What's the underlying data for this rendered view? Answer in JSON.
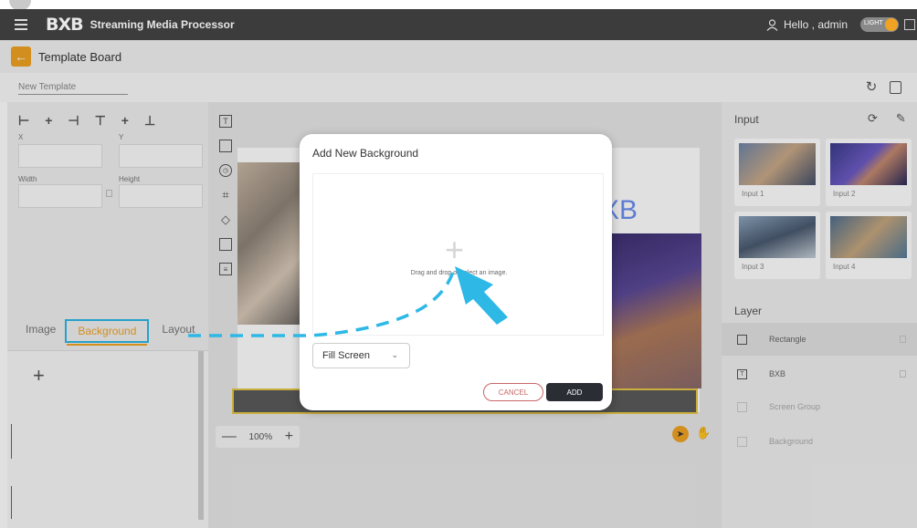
{
  "header": {
    "logo_text": "BXB",
    "app_title": "Streaming Media Processor",
    "greeting": "Hello , admin",
    "toggle_label": "LIGHT",
    "accent": "#f0a323"
  },
  "subheader": {
    "back_icon": "arrow-left-icon",
    "title": "Template Board"
  },
  "template": {
    "name_placeholder": "New Template"
  },
  "properties": {
    "x_label": "X",
    "y_label": "Y",
    "width_label": "Width",
    "height_label": "Height"
  },
  "tabs": {
    "image": "Image",
    "background": "Background",
    "layout": "Layout"
  },
  "canvas": {
    "brand_text": "XB",
    "zoom": "100%",
    "zoom_out": "—",
    "zoom_in": "+"
  },
  "input_panel": {
    "title": "Input",
    "inputs": [
      {
        "label": "Input 1"
      },
      {
        "label": "Input 2"
      },
      {
        "label": "Input 3"
      },
      {
        "label": "Input 4"
      }
    ]
  },
  "layer_panel": {
    "title": "Layer",
    "layers": [
      {
        "name": "Rectangle",
        "icon": "square-icon"
      },
      {
        "name": "BXB",
        "icon": "text-icon"
      },
      {
        "name": "Screen Group",
        "icon": "folder-icon"
      },
      {
        "name": "Background",
        "icon": "image-icon"
      }
    ]
  },
  "modal": {
    "title": "Add New Background",
    "dropzone_text": "Drag and drop or select an image.",
    "fill_mode": "Fill Screen",
    "cancel_label": "CANCEL",
    "add_label": "ADD"
  },
  "annotation_color": "#2db8e6"
}
